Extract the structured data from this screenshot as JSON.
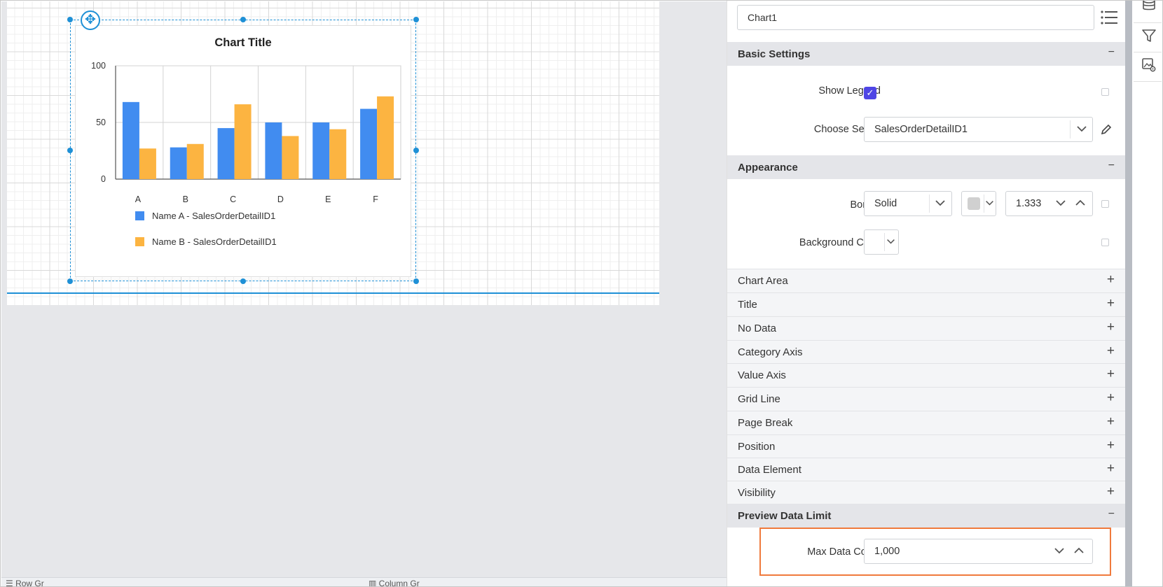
{
  "chart_data": {
    "type": "bar",
    "title": "Chart Title",
    "categories": [
      "A",
      "B",
      "C",
      "D",
      "E",
      "F"
    ],
    "yticks": [
      "0",
      "50",
      "100"
    ],
    "ylim": [
      0,
      100
    ],
    "grid": true,
    "legend_position": "bottom-left",
    "series": [
      {
        "name": "Name A - SalesOrderDetailID1",
        "color": "#418cf0",
        "values": [
          68,
          28,
          45,
          50,
          50,
          62
        ]
      },
      {
        "name": "Name B - SalesOrderDetailID1",
        "color": "#fcb441",
        "values": [
          27,
          31,
          66,
          38,
          44,
          73
        ]
      }
    ]
  },
  "properties": {
    "name_value": "Chart1",
    "list_icon": "list-icon",
    "basic_settings": {
      "title": "Basic Settings",
      "toggle": "−",
      "show_legend_label": "Show Legend",
      "show_legend_checked": true,
      "choose_series_label": "Choose Series",
      "choose_series_value": "SalesOrderDetailID1",
      "edit_icon": "pencil-icon"
    },
    "appearance": {
      "title": "Appearance",
      "toggle": "−",
      "border_label": "Border",
      "border_style": "Solid",
      "border_color": "#d0d0d0",
      "border_width": "1.333",
      "background_color_label": "Background Color"
    },
    "collapsed_sections": [
      {
        "label": "Chart Area",
        "toggle": "+"
      },
      {
        "label": "Title",
        "toggle": "+"
      },
      {
        "label": "No Data",
        "toggle": "+"
      },
      {
        "label": "Category Axis",
        "toggle": "+"
      },
      {
        "label": "Value Axis",
        "toggle": "+"
      },
      {
        "label": "Grid Line",
        "toggle": "+"
      },
      {
        "label": "Page Break",
        "toggle": "+"
      },
      {
        "label": "Position",
        "toggle": "+"
      },
      {
        "label": "Data Element",
        "toggle": "+"
      },
      {
        "label": "Visibility",
        "toggle": "+"
      }
    ],
    "preview_data_limit": {
      "title": "Preview Data Limit",
      "toggle": "−",
      "max_data_count_label": "Max Data Count",
      "max_data_count_value": "1,000"
    }
  },
  "bottom_bar": {
    "row_groups": "Row Gr",
    "column_groups": "Column Gr"
  },
  "right_toolbar": [
    "database-icon",
    "filter-icon",
    "image-settings-icon"
  ],
  "colors": {
    "accent": "#1e90d6",
    "checkbox": "#4f46e5",
    "highlight": "#f07a3c"
  }
}
